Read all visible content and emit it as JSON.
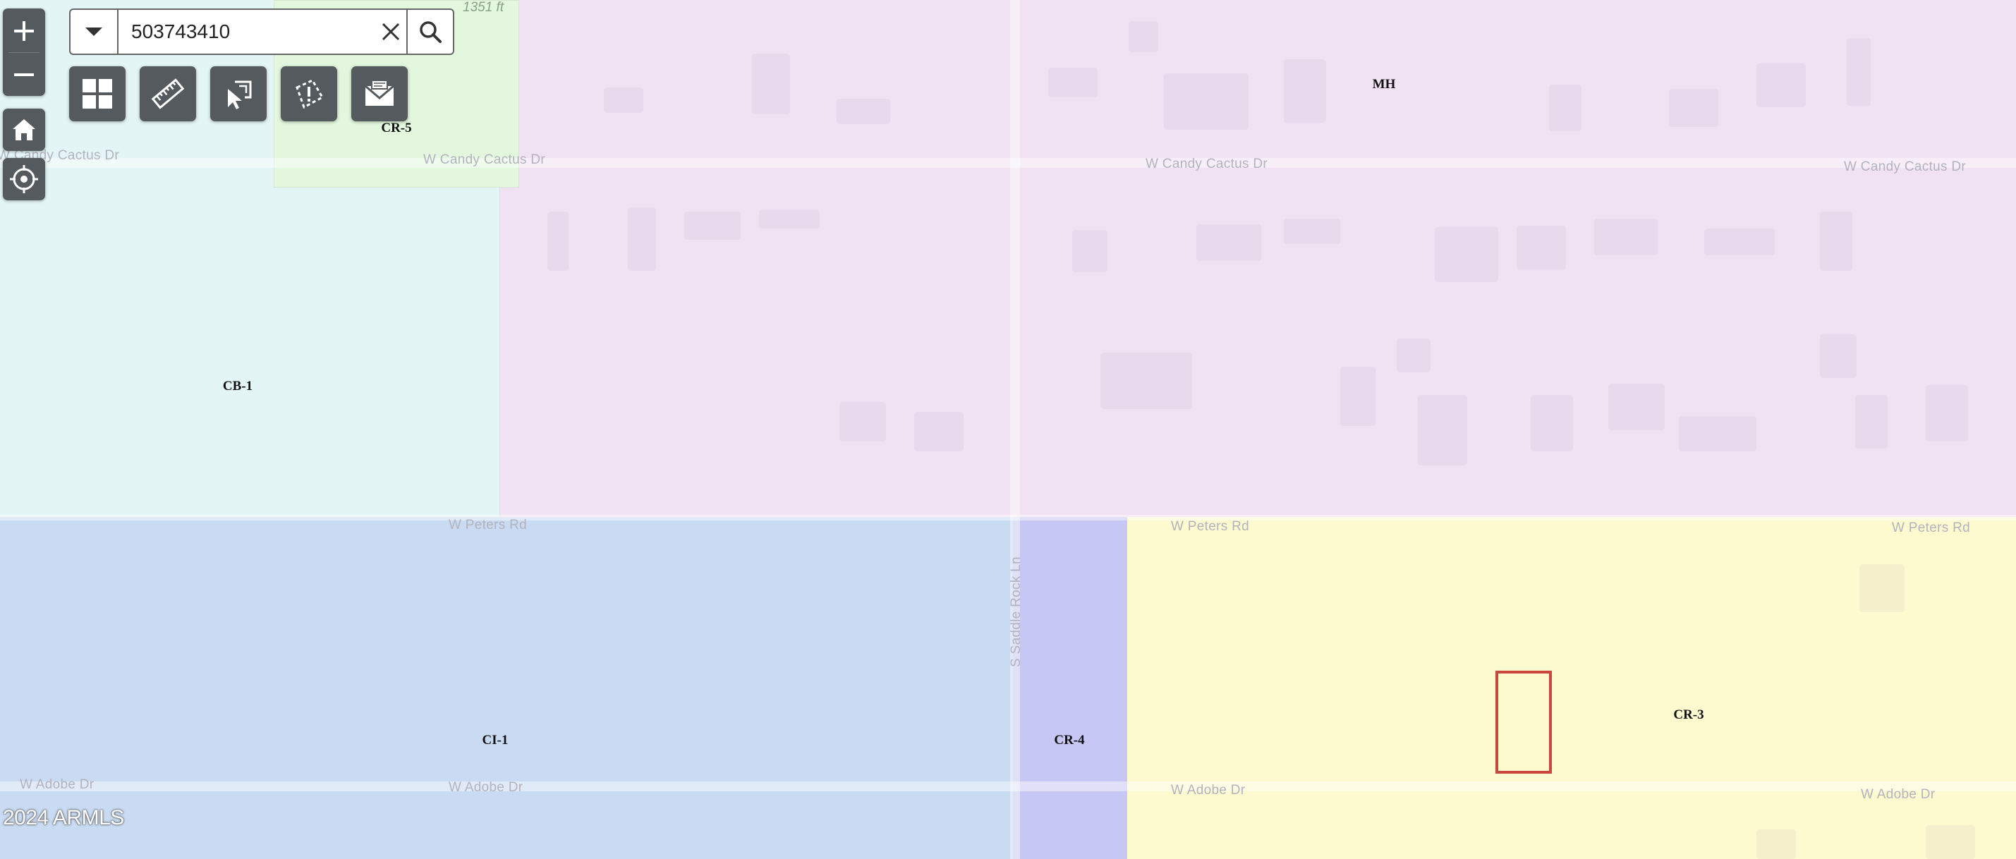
{
  "search": {
    "value": "503743410",
    "placeholder": ""
  },
  "scale_text": "1351 ft",
  "zones": [
    {
      "code": "MH"
    },
    {
      "code": "CR-5"
    },
    {
      "code": "CB-1"
    },
    {
      "code": "CI-1"
    },
    {
      "code": "CR-4"
    },
    {
      "code": "CR-3"
    }
  ],
  "streets": {
    "candy_cactus_left": "W Candy Cactus Dr",
    "candy_cactus_1": "W Candy Cactus Dr",
    "candy_cactus_2": "W Candy Cactus Dr",
    "candy_cactus_3": "W Candy Cactus Dr",
    "peters_1": "W Peters Rd",
    "peters_2": "W Peters Rd",
    "peters_3": "W Peters Rd",
    "adobe_1": "W Adobe Dr",
    "adobe_2": "W Adobe Dr",
    "adobe_3": "W Adobe Dr",
    "adobe_4": "W Adobe Dr",
    "saddle_rock": "S Saddle Rock Ln"
  },
  "copyright": "2024 ARMLS",
  "colors": {
    "mh": "#f0e1f3",
    "cb1": "#e3f6f5",
    "cr5": "#e2f7dd",
    "ci1": "#c9dbf3",
    "cr4": "#c6c7f4",
    "cr3": "#fdfad0",
    "parcel_outline": "#c9473c",
    "control_bg": "#555a5e"
  },
  "icons": [
    "zoom-in-icon",
    "zoom-out-icon",
    "home-icon",
    "locate-icon",
    "dropdown-icon",
    "clear-icon",
    "search-icon",
    "layers-grid-icon",
    "ruler-icon",
    "select-icon",
    "report-icon",
    "mail-icon"
  ]
}
